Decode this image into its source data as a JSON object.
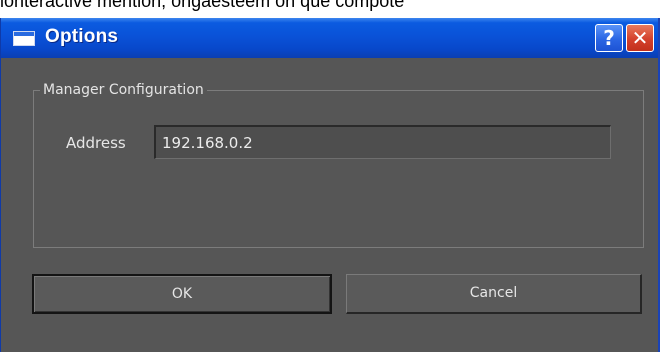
{
  "background_fragment": "ionteractive mention, ongaesteem on que compote",
  "window": {
    "title": "Options",
    "help_button_label": "?",
    "close_button_label": "✕"
  },
  "groupbox": {
    "title": "Manager Configuration",
    "address_label": "Address",
    "address_value": "192.168.0.2"
  },
  "buttons": {
    "ok_label": "OK",
    "cancel_label": "Cancel"
  },
  "colors": {
    "titlebar": "#0a52d8",
    "dialog_bg": "#565656",
    "close_button": "#d4412c"
  }
}
